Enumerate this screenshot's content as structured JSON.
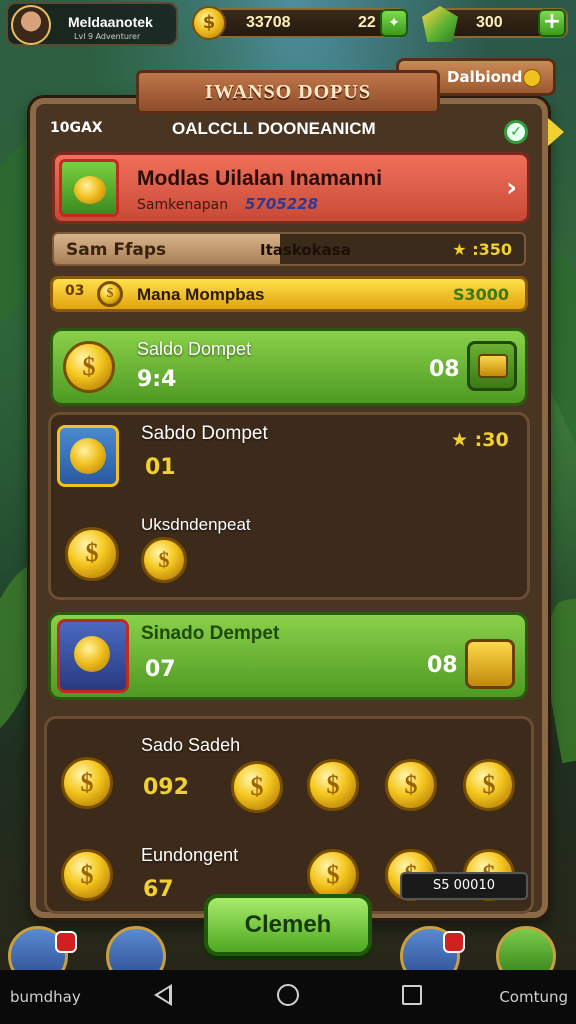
{
  "player": {
    "name": "Meldaanotek",
    "sub": "Lvl 9 Adventurer"
  },
  "resources": {
    "coins": "33708",
    "coins_secondary": "22",
    "gems": "300"
  },
  "panel": {
    "title": "IWANSO DOPUS",
    "diamond_tab": "Dalbiond",
    "header_left": "10GAX",
    "header_title": "OALCCLL DOONEANICM"
  },
  "featured": {
    "title": "Modlas Uilalan Inamanni",
    "subtitle": "Samkenapan",
    "value": "5705228"
  },
  "progress": {
    "label": "Sam Ffaps",
    "middle": "Itaskokasa",
    "value": "★ :350",
    "fill": 0.48
  },
  "highlight": {
    "icon_text": "03",
    "title": "Mana Mompbas",
    "value": "S3000"
  },
  "cards": [
    {
      "title": "Saldo Dompet",
      "value": "9:4",
      "count": "08"
    },
    {
      "title": "Sabdo Dompet",
      "value": "01",
      "star_value": "★ :30"
    },
    {
      "title": "Uksdndenpeat"
    },
    {
      "title": "Sinado Dempet",
      "value": "07",
      "count": "08"
    },
    {
      "title": "Sado Sadeh",
      "value": "092"
    },
    {
      "title": "Eundongent",
      "value": "67"
    }
  ],
  "coin_symbol": "$",
  "claim_label": "Clemeh",
  "mini_label": "S5 00010",
  "navbar": {
    "left": "bumdhay",
    "right": "Comtung"
  }
}
